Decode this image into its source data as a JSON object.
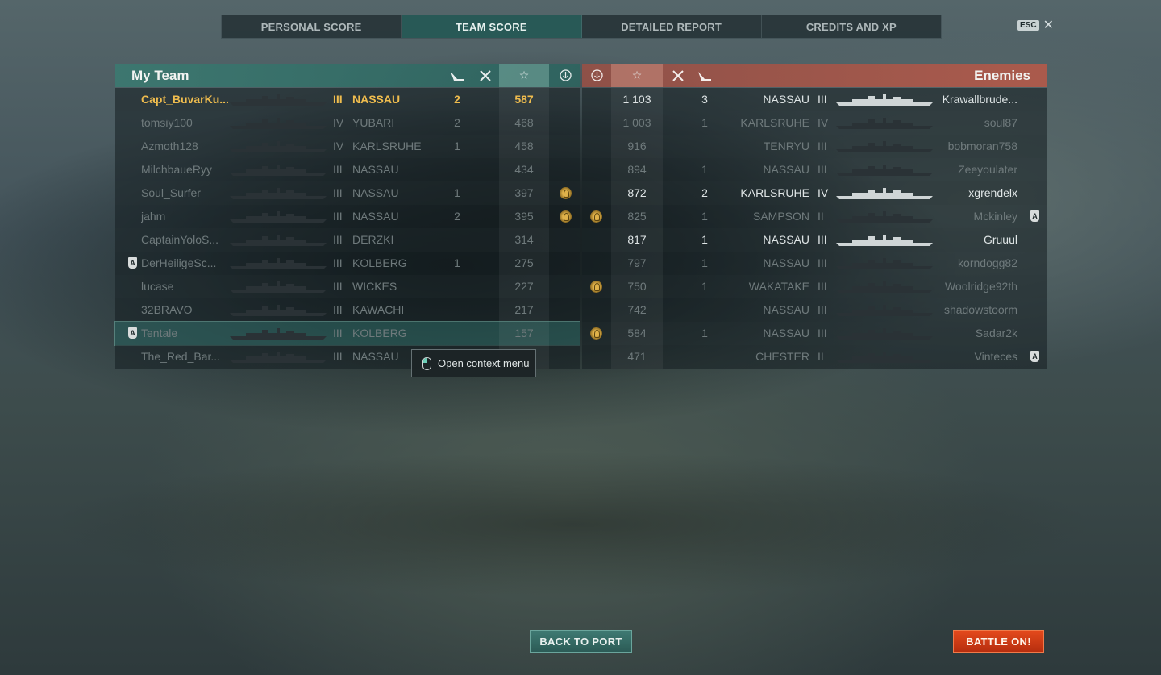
{
  "tabs": [
    {
      "label": "PERSONAL SCORE"
    },
    {
      "label": "TEAM SCORE"
    },
    {
      "label": "DETAILED REPORT"
    },
    {
      "label": "CREDITS AND XP"
    }
  ],
  "esc": {
    "key": "ESC",
    "close": "✕"
  },
  "left_header": {
    "title": "My Team"
  },
  "right_header": {
    "title": "Enemies"
  },
  "my_team": [
    {
      "name": "Capt_BuvarKu...",
      "tier": "III",
      "ship": "NASSAU",
      "kills": "2",
      "score": "587",
      "medal": false,
      "badge": false,
      "status": "me"
    },
    {
      "name": "tomsiy100",
      "tier": "IV",
      "ship": "YUBARI",
      "kills": "2",
      "score": "468",
      "medal": false,
      "badge": false,
      "status": "dead"
    },
    {
      "name": "Azmoth128",
      "tier": "IV",
      "ship": "KARLSRUHE",
      "kills": "1",
      "score": "458",
      "medal": false,
      "badge": false,
      "status": "dead"
    },
    {
      "name": "MilchbaueRyy",
      "tier": "III",
      "ship": "NASSAU",
      "kills": "",
      "score": "434",
      "medal": false,
      "badge": false,
      "status": "dead"
    },
    {
      "name": "Soul_Surfer",
      "tier": "III",
      "ship": "NASSAU",
      "kills": "1",
      "score": "397",
      "medal": true,
      "badge": false,
      "status": "dead"
    },
    {
      "name": "jahm",
      "tier": "III",
      "ship": "NASSAU",
      "kills": "2",
      "score": "395",
      "medal": true,
      "badge": false,
      "status": "dead"
    },
    {
      "name": "CaptainYoloS...",
      "tier": "III",
      "ship": "DERZKI",
      "kills": "",
      "score": "314",
      "medal": false,
      "badge": false,
      "status": "dead"
    },
    {
      "name": "DerHeiligeSc...",
      "tier": "III",
      "ship": "KOLBERG",
      "kills": "1",
      "score": "275",
      "medal": false,
      "badge": true,
      "status": "dead"
    },
    {
      "name": "lucase",
      "tier": "III",
      "ship": "WICKES",
      "kills": "",
      "score": "227",
      "medal": false,
      "badge": false,
      "status": "dead"
    },
    {
      "name": "32BRAVO",
      "tier": "III",
      "ship": "KAWACHI",
      "kills": "",
      "score": "217",
      "medal": false,
      "badge": false,
      "status": "dead"
    },
    {
      "name": "Tentale",
      "tier": "III",
      "ship": "KOLBERG",
      "kills": "",
      "score": "157",
      "medal": false,
      "badge": true,
      "status": "dead",
      "selected": true
    },
    {
      "name": "The_Red_Bar...",
      "tier": "III",
      "ship": "NASSAU",
      "kills": "",
      "score": "",
      "medal": false,
      "badge": false,
      "status": "dead"
    }
  ],
  "enemies": [
    {
      "name": "Krawallbrude...",
      "tier": "III",
      "ship": "NASSAU",
      "kills": "3",
      "score": "1 103",
      "medal": false,
      "badge": false,
      "status": "alive"
    },
    {
      "name": "soul87",
      "tier": "IV",
      "ship": "KARLSRUHE",
      "kills": "1",
      "score": "1 003",
      "medal": false,
      "badge": false,
      "status": "dead"
    },
    {
      "name": "bobmoran758",
      "tier": "III",
      "ship": "TENRYU",
      "kills": "",
      "score": "916",
      "medal": false,
      "badge": false,
      "status": "dead"
    },
    {
      "name": "Zeeyoulater",
      "tier": "III",
      "ship": "NASSAU",
      "kills": "1",
      "score": "894",
      "medal": false,
      "badge": false,
      "status": "dead"
    },
    {
      "name": "xgrendelx",
      "tier": "IV",
      "ship": "KARLSRUHE",
      "kills": "2",
      "score": "872",
      "medal": false,
      "badge": false,
      "status": "alive"
    },
    {
      "name": "Mckinley",
      "tier": "II",
      "ship": "SAMPSON",
      "kills": "1",
      "score": "825",
      "medal": true,
      "badge": true,
      "status": "dead"
    },
    {
      "name": "Gruuul",
      "tier": "III",
      "ship": "NASSAU",
      "kills": "1",
      "score": "817",
      "medal": false,
      "badge": false,
      "status": "alive"
    },
    {
      "name": "korndogg82",
      "tier": "III",
      "ship": "NASSAU",
      "kills": "1",
      "score": "797",
      "medal": false,
      "badge": false,
      "status": "dead"
    },
    {
      "name": "Woolridge92th",
      "tier": "III",
      "ship": "WAKATAKE",
      "kills": "1",
      "score": "750",
      "medal": true,
      "badge": false,
      "status": "dead"
    },
    {
      "name": "shadowstoorm",
      "tier": "III",
      "ship": "NASSAU",
      "kills": "",
      "score": "742",
      "medal": false,
      "badge": false,
      "status": "dead"
    },
    {
      "name": "Sadar2k",
      "tier": "III",
      "ship": "NASSAU",
      "kills": "1",
      "score": "584",
      "medal": true,
      "badge": false,
      "status": "dead"
    },
    {
      "name": "Vinteces",
      "tier": "II",
      "ship": "CHESTER",
      "kills": "",
      "score": "471",
      "medal": false,
      "badge": true,
      "status": "dead"
    }
  ],
  "context_menu": {
    "label": "Open context menu"
  },
  "buttons": {
    "back": "BACK TO PORT",
    "battle": "BATTLE ON!"
  },
  "colors": {
    "my_team": "#3c7870",
    "enemies": "#af5a4b",
    "player": "#f0bd4e",
    "battle": "#d43c18"
  },
  "icons": [
    "ship-sunk-icon",
    "plane-kill-icon",
    "star-icon",
    "medal-icon",
    "anchor-badge-icon",
    "mouse-icon"
  ]
}
